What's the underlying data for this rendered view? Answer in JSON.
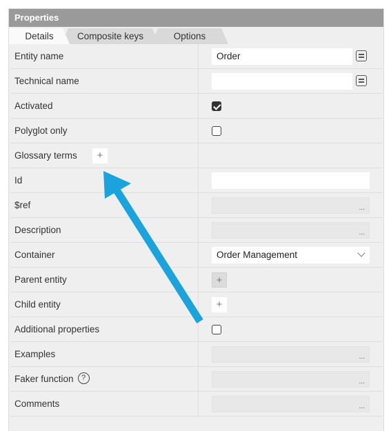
{
  "panel": {
    "title": "Properties"
  },
  "tabs": [
    {
      "label": "Details",
      "active": true
    },
    {
      "label": "Composite keys",
      "active": false
    },
    {
      "label": "Options",
      "active": false
    }
  ],
  "rows": {
    "entity_name": {
      "label": "Entity name",
      "value": "Order"
    },
    "technical_name": {
      "label": "Technical name",
      "value": ""
    },
    "activated": {
      "label": "Activated",
      "checked": true
    },
    "polyglot_only": {
      "label": "Polyglot only",
      "checked": false
    },
    "glossary_terms": {
      "label": "Glossary terms",
      "button": "+"
    },
    "id": {
      "label": "Id",
      "value": ""
    },
    "ref": {
      "label": "$ref",
      "button": "..."
    },
    "description": {
      "label": "Description",
      "button": "..."
    },
    "container": {
      "label": "Container",
      "value": "Order Management"
    },
    "parent_entity": {
      "label": "Parent entity",
      "button": "+"
    },
    "child_entity": {
      "label": "Child entity",
      "button": "+"
    },
    "additional_properties": {
      "label": "Additional properties",
      "checked": false
    },
    "examples": {
      "label": "Examples",
      "button": "..."
    },
    "faker_function": {
      "label": "Faker function",
      "help": "?",
      "button": "..."
    },
    "comments": {
      "label": "Comments",
      "button": "..."
    }
  },
  "annotation": {
    "color": "#1aa3dc"
  }
}
